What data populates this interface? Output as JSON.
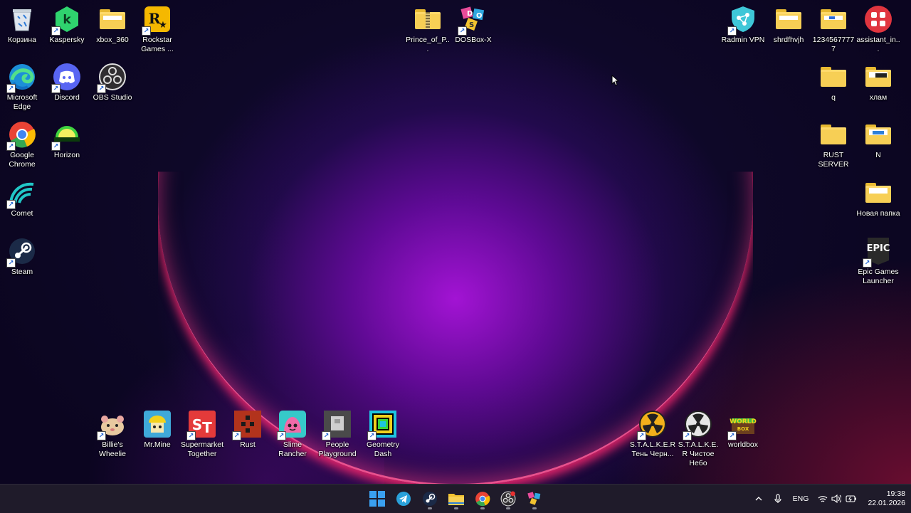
{
  "desktop_icons": {
    "recycle_bin": "Корзина",
    "kaspersky": "Kaspersky",
    "xbox_360": "xbox_360",
    "rockstar": "Rockstar Games ...",
    "prince": "Prince_of_P...",
    "dosbox": "DOSBox-X",
    "radmin": "Radmin VPN",
    "shrdfhvjh": "shrdfhvjh",
    "folder_123": "12345677777",
    "assistant": "assistant_in...",
    "edge": "Microsoft Edge",
    "discord": "Discord",
    "obs": "OBS Studio",
    "q": "q",
    "hlam": "хлам",
    "chrome": "Google Chrome",
    "horizon": "Horizon",
    "rust_server": "RUST SERVER",
    "n": "N",
    "comet": "Comet",
    "new_folder": "Новая папка",
    "steam": "Steam",
    "epic": "Epic Games Launcher",
    "epic_logo": "EPIC",
    "billie": "Billie's Wheelie",
    "mrmine": "Mr.Mine",
    "supermarket": "Supermarket Together",
    "rust": "Rust",
    "slime": "Slime Rancher",
    "people": "People Playground",
    "geometry": "Geometry Dash",
    "stalker1": "S.T.A.L.K.E.R Тень Черн...",
    "stalker2": "S.T.A.L.K.E.R Чистое Небо",
    "worldbox": "worldbox"
  },
  "taskbar": {
    "language": "ENG",
    "time": "19:38",
    "date": "22.01.2026"
  },
  "colors": {
    "folder": "#f7cf55",
    "taskbar": "#1f1b2a",
    "win_blue": "#3aa0f0"
  }
}
